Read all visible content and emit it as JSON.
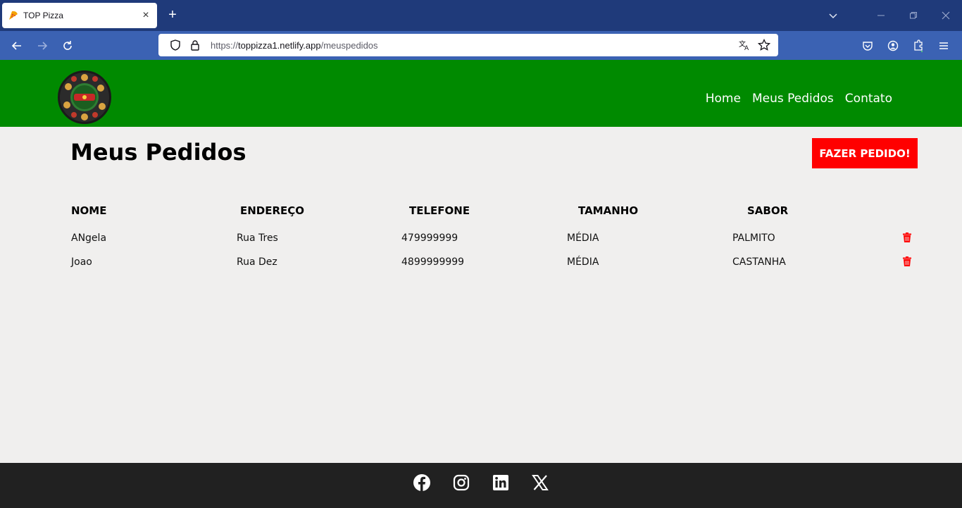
{
  "browser": {
    "tab_title": "TOP Pizza",
    "url_scheme": "https://",
    "url_host": "toppizza1.netlify.app",
    "url_path": "/meuspedidos"
  },
  "header": {
    "nav": [
      "Home",
      "Meus Pedidos",
      "Contato"
    ],
    "brand_color": "#008a00"
  },
  "main": {
    "title": "Meus Pedidos",
    "order_button": "FAZER PEDIDO!",
    "columns": [
      "NOME",
      "ENDEREÇO",
      "TELEFONE",
      "TAMANHO",
      "SABOR"
    ],
    "rows": [
      [
        "ANgela",
        "Rua Tres",
        "479999999",
        "MÉDIA",
        "PALMITO"
      ],
      [
        "Joao",
        "Rua Dez",
        "4899999999",
        "MÉDIA",
        "CASTANHA"
      ]
    ],
    "delete_icon": "trash-icon",
    "accent_color": "#ff0000"
  },
  "footer": {
    "social": [
      "facebook-icon",
      "instagram-icon",
      "linkedin-icon",
      "x-icon"
    ]
  }
}
